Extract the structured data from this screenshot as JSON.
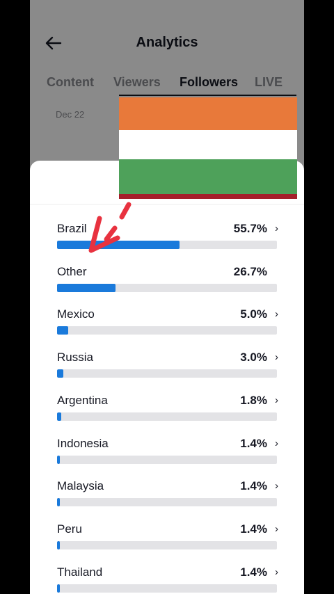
{
  "header": {
    "title": "Analytics",
    "back_icon": "arrow-left-icon"
  },
  "tabs": [
    {
      "label": "Content",
      "active": false
    },
    {
      "label": "Viewers",
      "active": false
    },
    {
      "label": "Followers",
      "active": true
    },
    {
      "label": "LIVE",
      "active": false
    }
  ],
  "date_label": "Dec 22",
  "flag": {
    "colors": [
      "#e8793a",
      "#ffffff",
      "#4ea15a",
      "#a51f2b"
    ]
  },
  "countries": [
    {
      "name": "Brazil",
      "pct_label": "55.7%",
      "pct": 55.7,
      "chevron": true
    },
    {
      "name": "Other",
      "pct_label": "26.7%",
      "pct": 26.7,
      "chevron": false
    },
    {
      "name": "Mexico",
      "pct_label": "5.0%",
      "pct": 5.0,
      "chevron": true
    },
    {
      "name": "Russia",
      "pct_label": "3.0%",
      "pct": 3.0,
      "chevron": true
    },
    {
      "name": "Argentina",
      "pct_label": "1.8%",
      "pct": 1.8,
      "chevron": true
    },
    {
      "name": "Indonesia",
      "pct_label": "1.4%",
      "pct": 1.4,
      "chevron": true
    },
    {
      "name": "Malaysia",
      "pct_label": "1.4%",
      "pct": 1.4,
      "chevron": true
    },
    {
      "name": "Peru",
      "pct_label": "1.4%",
      "pct": 1.4,
      "chevron": true
    },
    {
      "name": "Thailand",
      "pct_label": "1.4%",
      "pct": 1.4,
      "chevron": true
    }
  ],
  "colors": {
    "bar_fill": "#1a7adb",
    "bar_track": "#e3e3e6",
    "annotation": "#e8323f"
  }
}
